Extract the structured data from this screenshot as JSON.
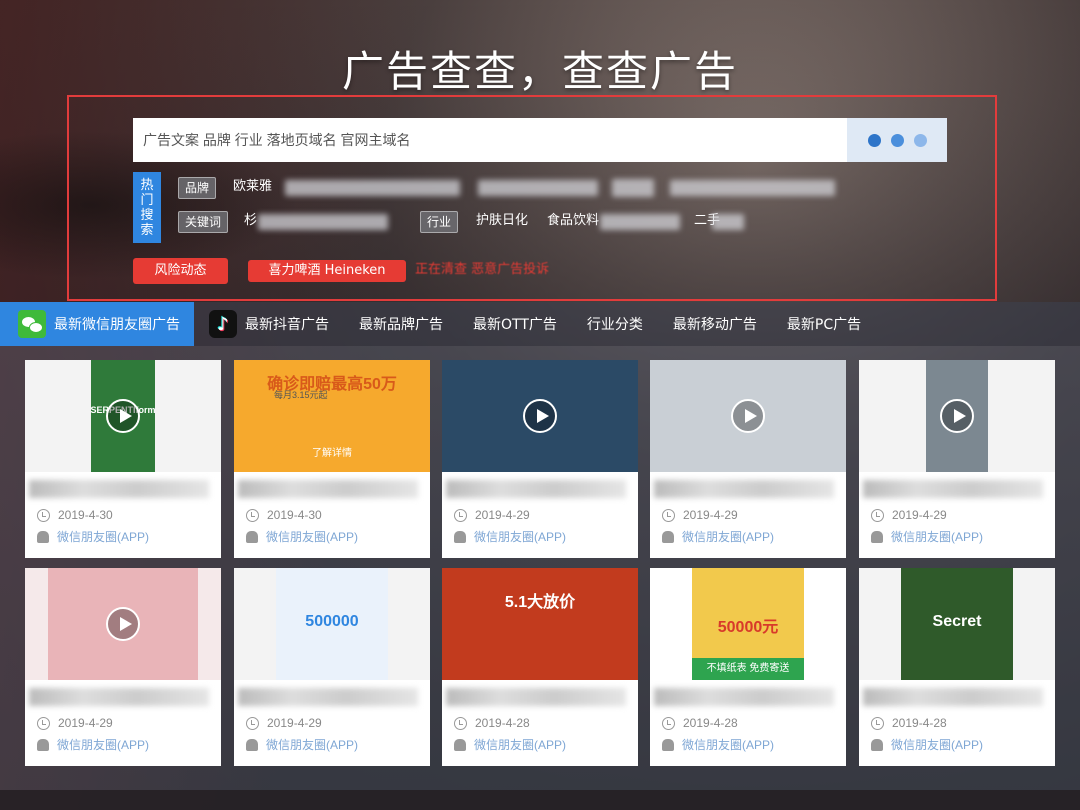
{
  "page": {
    "title": "广告查查，查查广告"
  },
  "search": {
    "placeholder": "广告文案 品牌 行业 落地页域名 官网主域名"
  },
  "hot": {
    "label": [
      "热",
      "门",
      "搜",
      "索"
    ],
    "brand_tag": "品牌",
    "brand_item": "欧莱雅",
    "keyword_tag": "关键词",
    "keyword_item": "杉",
    "industry_tag": "行业",
    "industry_items": [
      "护肤日化",
      "食品饮料",
      "二手"
    ]
  },
  "actions": {
    "risk_button": "风险动态",
    "heineken_button": "喜力啤酒 Heineken",
    "red_text": "正在清查 恶意广告投诉"
  },
  "tabs": [
    {
      "label": "最新微信朋友圈广告",
      "icon": "wechat-icon",
      "active": true
    },
    {
      "label": "最新抖音广告",
      "icon": "douyin-icon",
      "active": false
    },
    {
      "label": "最新品牌广告",
      "active": false
    },
    {
      "label": "最新OTT广告",
      "active": false
    },
    {
      "label": "行业分类",
      "active": false
    },
    {
      "label": "最新移动广告",
      "active": false
    },
    {
      "label": "最新PC广告",
      "active": false
    }
  ],
  "cards": [
    {
      "date": "2019-4-30",
      "source": "微信朋友圈(APP)",
      "thumb_text": "SERPENTIform",
      "video": true,
      "bg": "#f3f3f3",
      "img": "#2f7a3a"
    },
    {
      "date": "2019-4-30",
      "source": "微信朋友圈(APP)",
      "thumb_text": "确诊即赔最高50万",
      "sub_text": "每月3.15元起",
      "cta": "了解详情",
      "video": false,
      "bg": "#fdf3e6",
      "img": "#f6a92d"
    },
    {
      "date": "2019-4-29",
      "source": "微信朋友圈(APP)",
      "video": true,
      "bg": "#14283c",
      "img": "#2b4a66"
    },
    {
      "date": "2019-4-29",
      "source": "微信朋友圈(APP)",
      "video": true,
      "bg": "#e9ecef",
      "img": "#c9cfd5"
    },
    {
      "date": "2019-4-29",
      "source": "微信朋友圈(APP)",
      "video": true,
      "bg": "#f3f3f3",
      "img": "#7c8891"
    },
    {
      "date": "2019-4-29",
      "source": "微信朋友圈(APP)",
      "video": true,
      "bg": "#f5e9ea",
      "img": "#e9b4b8"
    },
    {
      "date": "2019-4-29",
      "source": "微信朋友圈(APP)",
      "thumb_text": "500000",
      "video": false,
      "bg": "#f3f3f3",
      "img": "#eaf2fb"
    },
    {
      "date": "2019-4-28",
      "source": "微信朋友圈(APP)",
      "thumb_text": "5.1大放价",
      "video": false,
      "bg": "#7a2a1a",
      "img": "#c23b1e"
    },
    {
      "date": "2019-4-28",
      "source": "微信朋友圈(APP)",
      "thumb_text": "50000元",
      "banner": "不填纸表 免费寄送",
      "video": false,
      "bg": "#ffffff",
      "img": "#f2c94c"
    },
    {
      "date": "2019-4-28",
      "source": "微信朋友圈(APP)",
      "thumb_text": "Secret",
      "video": false,
      "bg": "#f3f3f3",
      "img": "#2f5a2a"
    }
  ],
  "colors": {
    "accent": "#2f86e0",
    "danger": "#e63b34",
    "frame": "#e23c3c"
  }
}
